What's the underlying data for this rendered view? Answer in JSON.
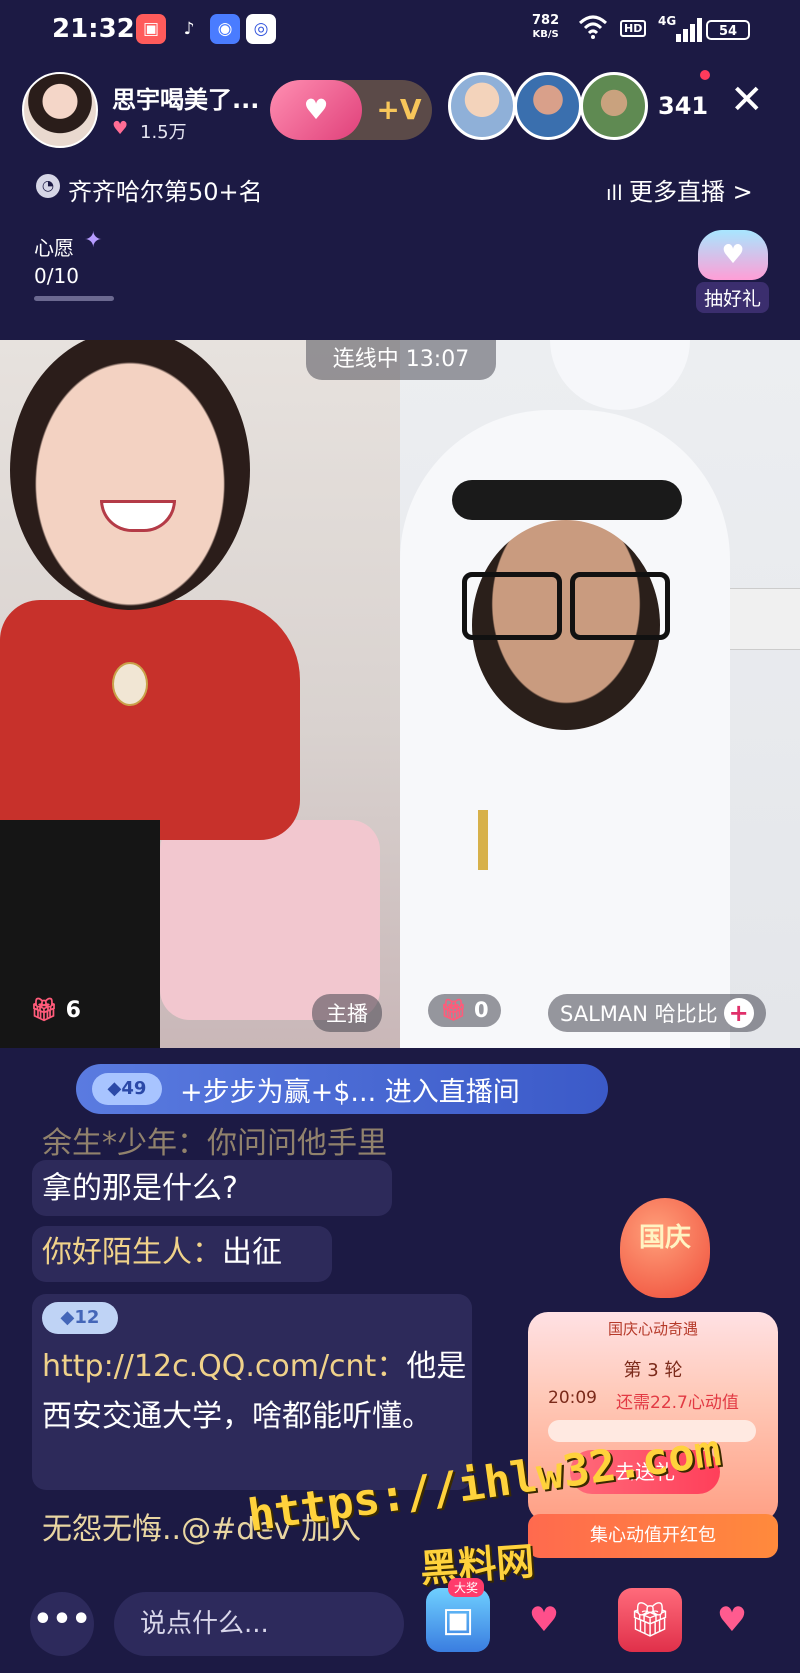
{
  "status_bar": {
    "time": "21:32",
    "net_speed_value": "782",
    "net_speed_unit": "KB/S",
    "hd_label": "HD",
    "network": "4G",
    "battery": "54"
  },
  "host": {
    "name": "思宇喝美了...",
    "fans": "1.5万"
  },
  "follow": {
    "v_label": "+V"
  },
  "viewers": {
    "count": "341"
  },
  "rank": {
    "text": "齐齐哈尔第50+名"
  },
  "more_live": {
    "label": "更多直播 >"
  },
  "wish": {
    "label": "心愿",
    "progress": "0/10"
  },
  "lucky_gift": {
    "label": "抽好礼"
  },
  "link": {
    "status": "连线中",
    "timer": "13:07"
  },
  "left_stream": {
    "gift_count": "6",
    "host_tag": "主播"
  },
  "right_stream": {
    "gift_count": "0",
    "guest_name": "SALMAN 哈比比"
  },
  "enter_banner": {
    "level": "49",
    "text": "+步步为赢+$... 进入直播间"
  },
  "chat": {
    "msg1": {
      "name": "余生*少年：",
      "text": "你问问他手里",
      "text2": "拿的那是什么?"
    },
    "msg2": {
      "name": "你好陌生人：",
      "text": "出征"
    },
    "msg3": {
      "badge": "12",
      "name": "http://12c.QQ.com/cnt：",
      "text": "他是西安交通大学，啥都能听懂。"
    },
    "msg4": {
      "text": "无怨无悔..@#dev 加入"
    }
  },
  "event": {
    "badge": "国庆",
    "title": "国庆心动奇遇",
    "round": "第 3 轮",
    "time": "20:09",
    "remain": "还需22.7心动值",
    "button": "去送礼",
    "footer": "集心动值开红包"
  },
  "watermark": {
    "line1": "https://ihlw32.com",
    "line2": "黑料网"
  },
  "bottom_bar": {
    "more": "•••",
    "input_placeholder": "说点什么...",
    "treasure_tag": "大奖"
  },
  "colors": {
    "background": "#1c1a44",
    "accent_pink": "#ff3b6b",
    "gold": "#f0d28a"
  }
}
